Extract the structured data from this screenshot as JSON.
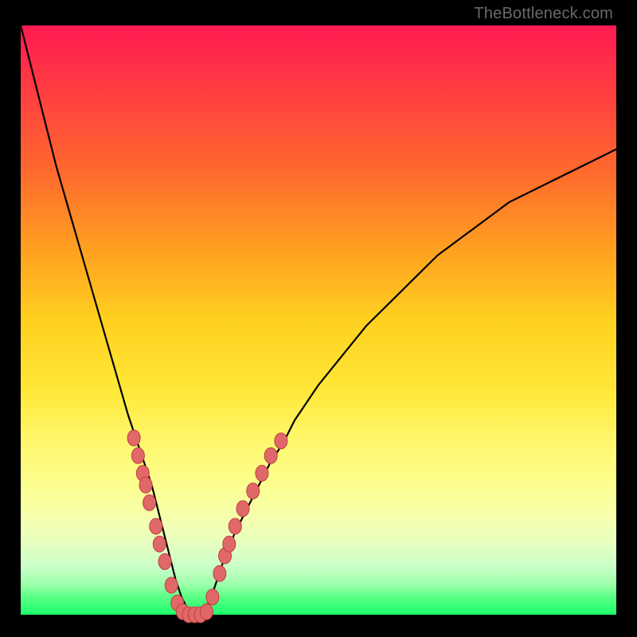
{
  "watermark_text": "TheBottleneck.com",
  "chart_data": {
    "type": "line",
    "title": "",
    "xlabel": "",
    "ylabel": "",
    "xlim": [
      0,
      100
    ],
    "ylim": [
      0,
      100
    ],
    "grid": false,
    "legend": false,
    "series": [
      {
        "name": "bottleneck-curve",
        "x": [
          0,
          2,
          4,
          6,
          8,
          10,
          12,
          14,
          16,
          18,
          20,
          21,
          22,
          23,
          24,
          25,
          26,
          27,
          28,
          29,
          30,
          31,
          32,
          33,
          34,
          36,
          38,
          40,
          42,
          44,
          46,
          48,
          50,
          54,
          58,
          62,
          66,
          70,
          74,
          78,
          82,
          86,
          90,
          94,
          98,
          100
        ],
        "y": [
          100,
          92,
          84,
          76,
          69,
          62,
          55,
          48,
          41,
          34,
          28,
          25,
          22,
          18,
          14,
          10,
          6,
          3,
          1,
          0,
          0,
          1,
          3,
          6,
          9,
          14,
          18,
          22,
          26,
          29,
          33,
          36,
          39,
          44,
          49,
          53,
          57,
          61,
          64,
          67,
          70,
          72,
          74,
          76,
          78,
          79
        ]
      }
    ],
    "markers": [
      {
        "name": "left-marker-1",
        "x": 19.0,
        "y": 30
      },
      {
        "name": "left-marker-2",
        "x": 19.7,
        "y": 27
      },
      {
        "name": "left-marker-3",
        "x": 20.5,
        "y": 24
      },
      {
        "name": "left-marker-4",
        "x": 21.0,
        "y": 22
      },
      {
        "name": "left-marker-5",
        "x": 21.6,
        "y": 19
      },
      {
        "name": "left-marker-6",
        "x": 22.7,
        "y": 15
      },
      {
        "name": "left-marker-7",
        "x": 23.3,
        "y": 12
      },
      {
        "name": "left-marker-8",
        "x": 24.2,
        "y": 9
      },
      {
        "name": "left-marker-9",
        "x": 25.3,
        "y": 5
      },
      {
        "name": "left-marker-10",
        "x": 26.3,
        "y": 2
      },
      {
        "name": "bottom-marker-1",
        "x": 27.2,
        "y": 0.5
      },
      {
        "name": "bottom-marker-2",
        "x": 28.2,
        "y": 0
      },
      {
        "name": "bottom-marker-3",
        "x": 29.2,
        "y": 0
      },
      {
        "name": "bottom-marker-4",
        "x": 30.2,
        "y": 0
      },
      {
        "name": "bottom-marker-5",
        "x": 31.2,
        "y": 0.5
      },
      {
        "name": "right-marker-1",
        "x": 32.2,
        "y": 3
      },
      {
        "name": "right-marker-2",
        "x": 33.4,
        "y": 7
      },
      {
        "name": "right-marker-3",
        "x": 34.3,
        "y": 10
      },
      {
        "name": "right-marker-4",
        "x": 35.0,
        "y": 12
      },
      {
        "name": "right-marker-5",
        "x": 36.0,
        "y": 15
      },
      {
        "name": "right-marker-6",
        "x": 37.3,
        "y": 18
      },
      {
        "name": "right-marker-7",
        "x": 39.0,
        "y": 21
      },
      {
        "name": "right-marker-8",
        "x": 40.5,
        "y": 24
      },
      {
        "name": "right-marker-9",
        "x": 42.0,
        "y": 27
      },
      {
        "name": "right-marker-10",
        "x": 43.7,
        "y": 29.5
      }
    ],
    "marker_style": {
      "fill": "#e06868",
      "stroke": "#c04040",
      "rx": 8,
      "ry": 10
    },
    "curve_style": {
      "stroke": "#000000",
      "width": 2.2
    }
  }
}
